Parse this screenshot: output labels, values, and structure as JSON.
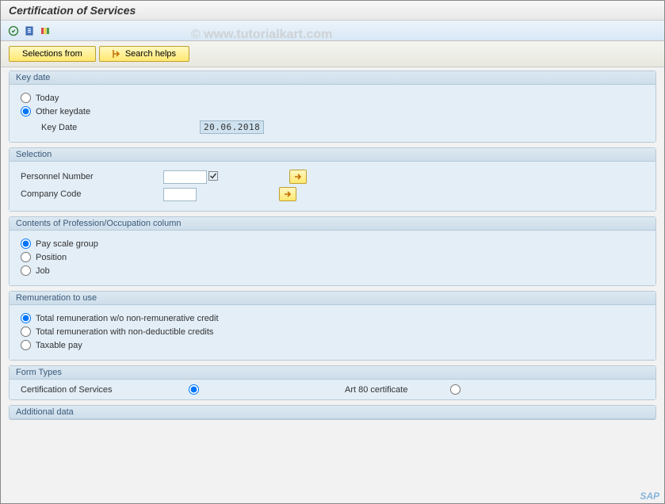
{
  "title": "Certification of Services",
  "watermark": "© www.tutorialkart.com",
  "toolbar": {
    "selections_from": "Selections from",
    "search_helps": "Search helps"
  },
  "keydate": {
    "header": "Key date",
    "today": "Today",
    "other": "Other keydate",
    "key_date_label": "Key Date",
    "key_date_value": "20.06.2018"
  },
  "selection": {
    "header": "Selection",
    "personnel_label": "Personnel Number",
    "personnel_value": "",
    "company_label": "Company Code",
    "company_value": ""
  },
  "profession": {
    "header": "Contents of Profession/Occupation column",
    "pay_scale": "Pay scale group",
    "position": "Position",
    "job": "Job"
  },
  "remuneration": {
    "header": "Remuneration to use",
    "opt1": "Total remuneration w/o non-remunerative credit",
    "opt2": "Total remuneration with non-deductible credits",
    "opt3": "Taxable pay"
  },
  "form_types": {
    "header": "Form Types",
    "cert_label": "Certification of Services",
    "art80_label": "Art 80 certificate"
  },
  "additional": {
    "header": "Additional data"
  },
  "sap": "SAP"
}
